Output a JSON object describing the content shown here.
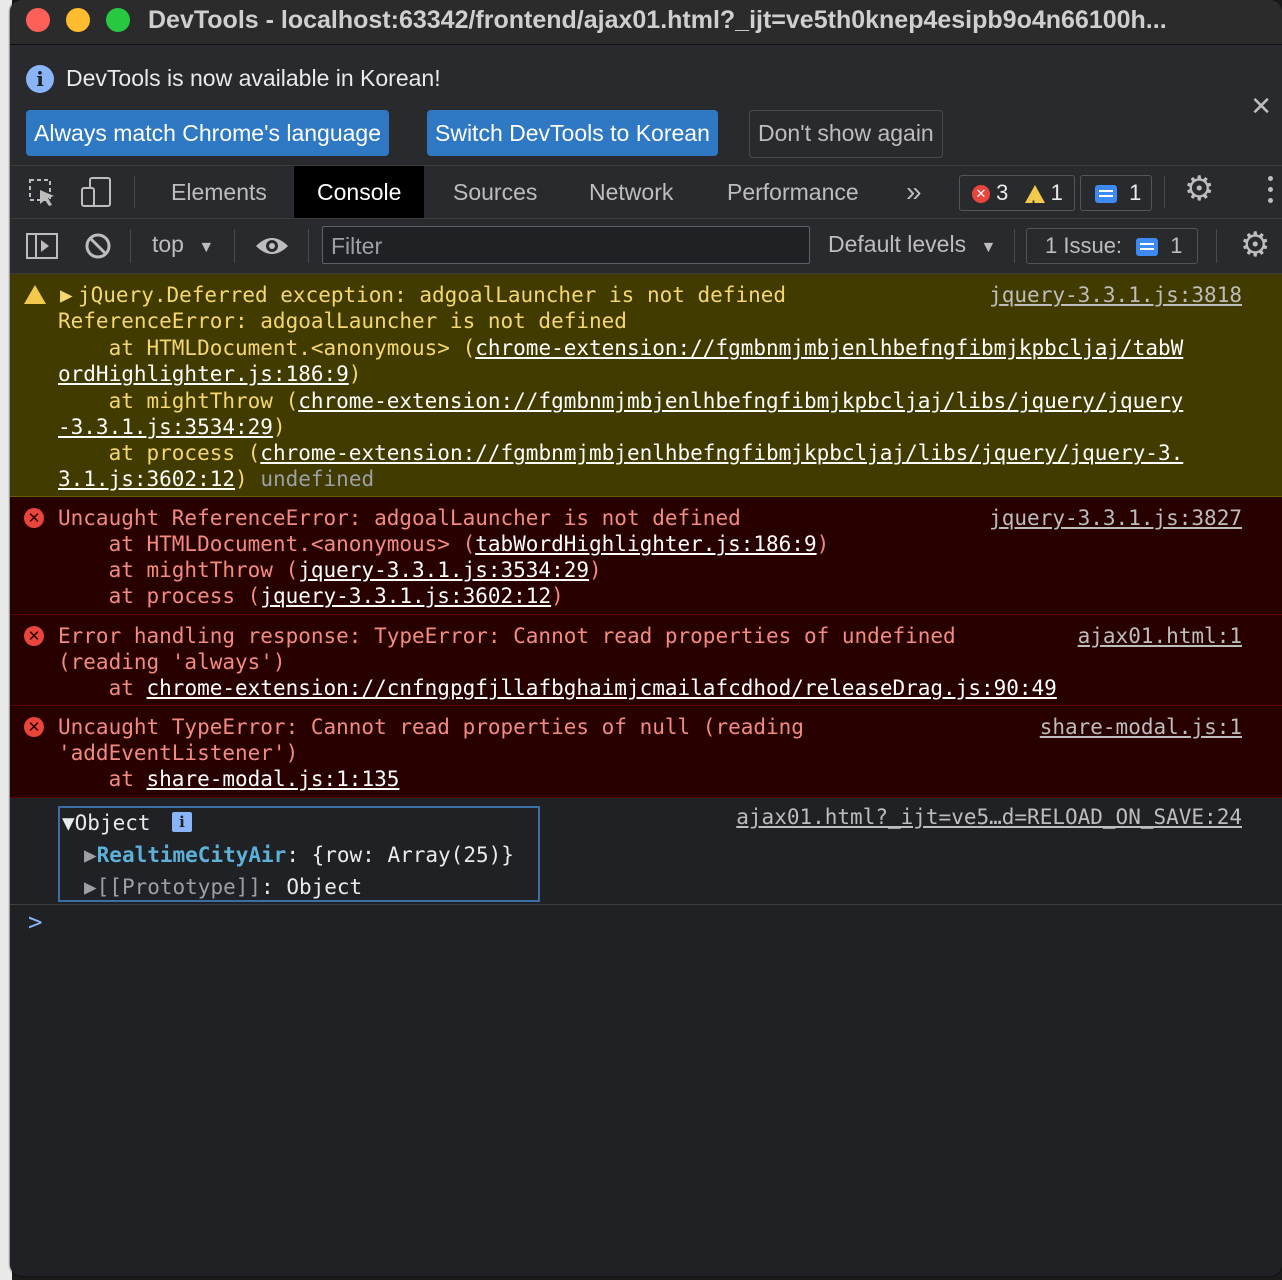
{
  "window": {
    "title": "DevTools - localhost:63342/frontend/ajax01.html?_ijt=ve5th0knep4esipb9o4n66100h..."
  },
  "infobar": {
    "message": "DevTools is now available in Korean!",
    "buttons": [
      "Always match Chrome's language",
      "Switch DevTools to Korean",
      "Don't show again"
    ]
  },
  "tabs": {
    "items": [
      "Elements",
      "Console",
      "Sources",
      "Network",
      "Performance"
    ],
    "active": "Console",
    "more": "»",
    "errors_count": "3",
    "warnings_count": "1",
    "messages_count": "1"
  },
  "toolbar": {
    "context": "top",
    "filter_placeholder": "Filter",
    "levels": "Default levels",
    "issues_label": "1 Issue:",
    "issues_count": "1"
  },
  "console": {
    "warn1": {
      "line1": "jQuery.Deferred exception: adgoalLauncher is not defined",
      "source": "jquery-3.3.1.js:3818",
      "line2": "ReferenceError: adgoalLauncher is not defined",
      "at1_prefix": "    at HTMLDocument.<anonymous> (",
      "at1_link_a": "chrome-extension://fgmbnmjmbjenlhbefngfibmjkpbcljaj/tabW",
      "at1_link_b": "ordHighlighter.js:186:9",
      "at2_prefix": "    at mightThrow (",
      "at2_link_a": "chrome-extension://fgmbnmjmbjenlhbefngfibmjkpbcljaj/libs/jquery/jquery",
      "at2_link_b": "-3.3.1.js:3534:29",
      "at3_prefix": "    at process (",
      "at3_link_a": "chrome-extension://fgmbnmjmbjenlhbefngfibmjkpbcljaj/libs/jquery/jquery-3.",
      "at3_link_b": "3.1.js:3602:12",
      "trailing": "undefined"
    },
    "err1": {
      "line1": "Uncaught ReferenceError: adgoalLauncher is not defined",
      "source": "jquery-3.3.1.js:3827",
      "at1_prefix": "    at HTMLDocument.<anonymous> (",
      "at1_link": "tabWordHighlighter.js:186:9",
      "at2_prefix": "    at mightThrow (",
      "at2_link": "jquery-3.3.1.js:3534:29",
      "at3_prefix": "    at process (",
      "at3_link": "jquery-3.3.1.js:3602:12"
    },
    "err2": {
      "line1": "Error handling response: TypeError: Cannot read properties of undefined",
      "source": "ajax01.html:1",
      "line2": "(reading 'always')",
      "at_prefix": "    at ",
      "at_link": "chrome-extension://cnfngpgfjllafbghaimjcmailafcdhod/releaseDrag.js:90:49"
    },
    "err3": {
      "line1": "Uncaught TypeError: Cannot read properties of null (reading",
      "source": "share-modal.js:1",
      "line2": "'addEventListener')",
      "at_prefix": "    at ",
      "at_link": "share-modal.js:1:135"
    },
    "log": {
      "source": "ajax01.html?_ijt=ve5…d=RELOAD_ON_SAVE:24",
      "label": "Object",
      "prop1_key": "RealtimeCityAir",
      "prop1_val": "{row: Array(25)}",
      "prop2_key": "[[Prototype]]",
      "prop2_val": "Object"
    },
    "prompt": ">"
  }
}
